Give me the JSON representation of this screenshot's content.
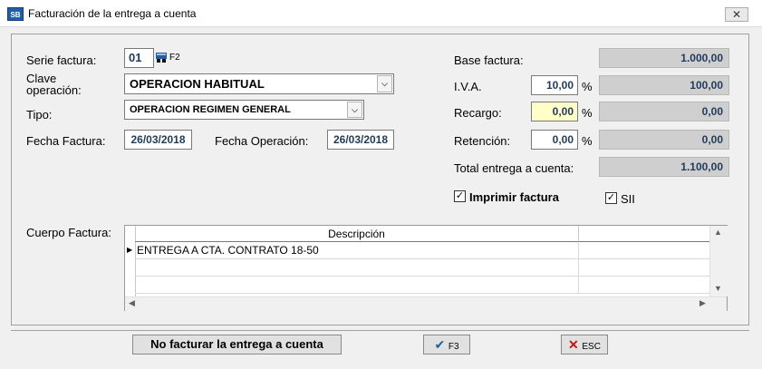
{
  "window": {
    "title": "Facturación de la entrega a cuenta",
    "icon_text": "SB",
    "close_label": "✕"
  },
  "form": {
    "serie_label": "Serie factura:",
    "serie_value": "01",
    "serie_key": "F2",
    "clave_label_line1": "Clave",
    "clave_label_line2": "operación:",
    "clave_value": "OPERACION HABITUAL",
    "tipo_label": "Tipo:",
    "tipo_value": "OPERACION REGIMEN GENERAL",
    "fecha_factura_label": "Fecha Factura:",
    "fecha_factura_value": "26/03/2018",
    "fecha_operacion_label": "Fecha Operación:",
    "fecha_operacion_value": "26/03/2018"
  },
  "totals": {
    "base_label": "Base factura:",
    "base_value": "1.000,00",
    "iva_label": "I.V.A.",
    "iva_pct": "10,00",
    "iva_value": "100,00",
    "recargo_label": "Recargo:",
    "recargo_pct": "0,00",
    "recargo_value": "0,00",
    "retencion_label": "Retención:",
    "retencion_pct": "0,00",
    "retencion_value": "0,00",
    "total_label": "Total entrega a cuenta:",
    "total_value": "1.100,00",
    "pct_symbol": "%"
  },
  "options": {
    "imprimir_label": "Imprimir factura",
    "imprimir_checked": "✓",
    "sii_label": "SII",
    "sii_checked": "✓"
  },
  "body": {
    "label": "Cuerpo Factura:",
    "column": "Descripción",
    "rows": [
      "ENTREGA A CTA. CONTRATO 18-50",
      "",
      ""
    ],
    "row_indicator": "▶"
  },
  "footer": {
    "no_facturar_label": "No facturar la entrega a cuenta",
    "accept_icon": "✔",
    "accept_key": "F3",
    "cancel_icon": "✕",
    "cancel_key": "ESC"
  }
}
